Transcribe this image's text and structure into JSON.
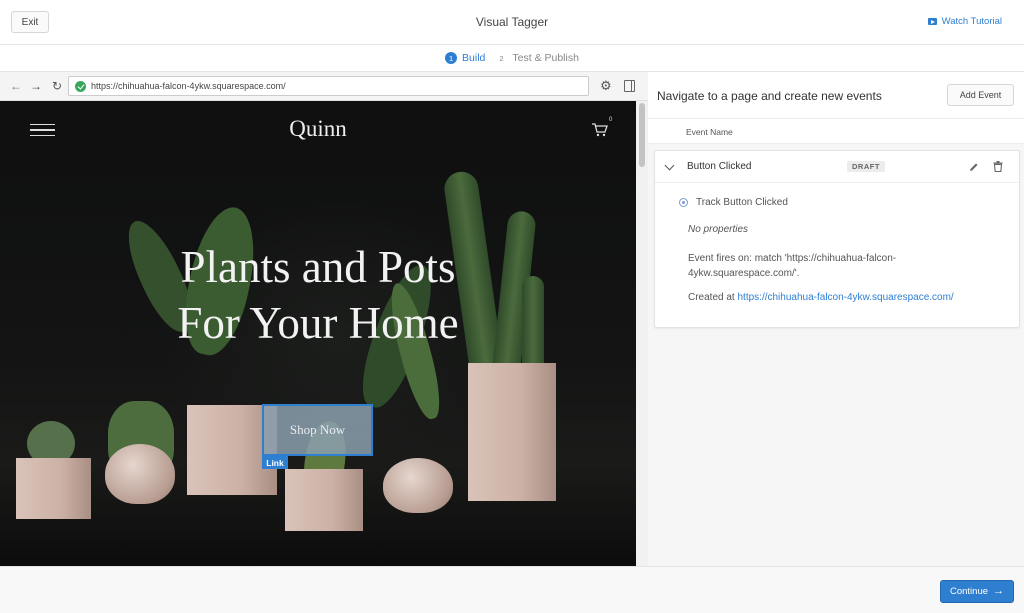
{
  "topbar": {
    "exit_label": "Exit",
    "title": "Visual Tagger",
    "watch_label": "Watch Tutorial"
  },
  "steps": [
    {
      "num": "1",
      "label": "Build",
      "active": true
    },
    {
      "num": "2",
      "label": "Test & Publish",
      "active": false
    }
  ],
  "browser": {
    "url": "https://chihuahua-falcon-4ykw.squarespace.com/"
  },
  "site": {
    "logo": "Quinn",
    "cart_count": "0",
    "hero_line1": "Plants and Pots",
    "hero_line2": "For Your Home",
    "shop_label": "Shop Now",
    "link_tag": "Link"
  },
  "panel": {
    "title": "Navigate to a page and create new events",
    "add_event_label": "Add Event",
    "column_header": "Event Name",
    "event": {
      "name": "Button Clicked",
      "status": "DRAFT",
      "track_label": "Track Button Clicked",
      "properties": "No properties",
      "fires_on": "Event fires on: match 'https://chihuahua-falcon-4ykw.squarespace.com/'.",
      "created_prefix": "Created at ",
      "created_url": "https://chihuahua-falcon-4ykw.squarespace.com/"
    }
  },
  "footer": {
    "continue_label": "Continue"
  },
  "colors": {
    "accent": "#2f7fd1",
    "secure": "#3aa55d"
  }
}
